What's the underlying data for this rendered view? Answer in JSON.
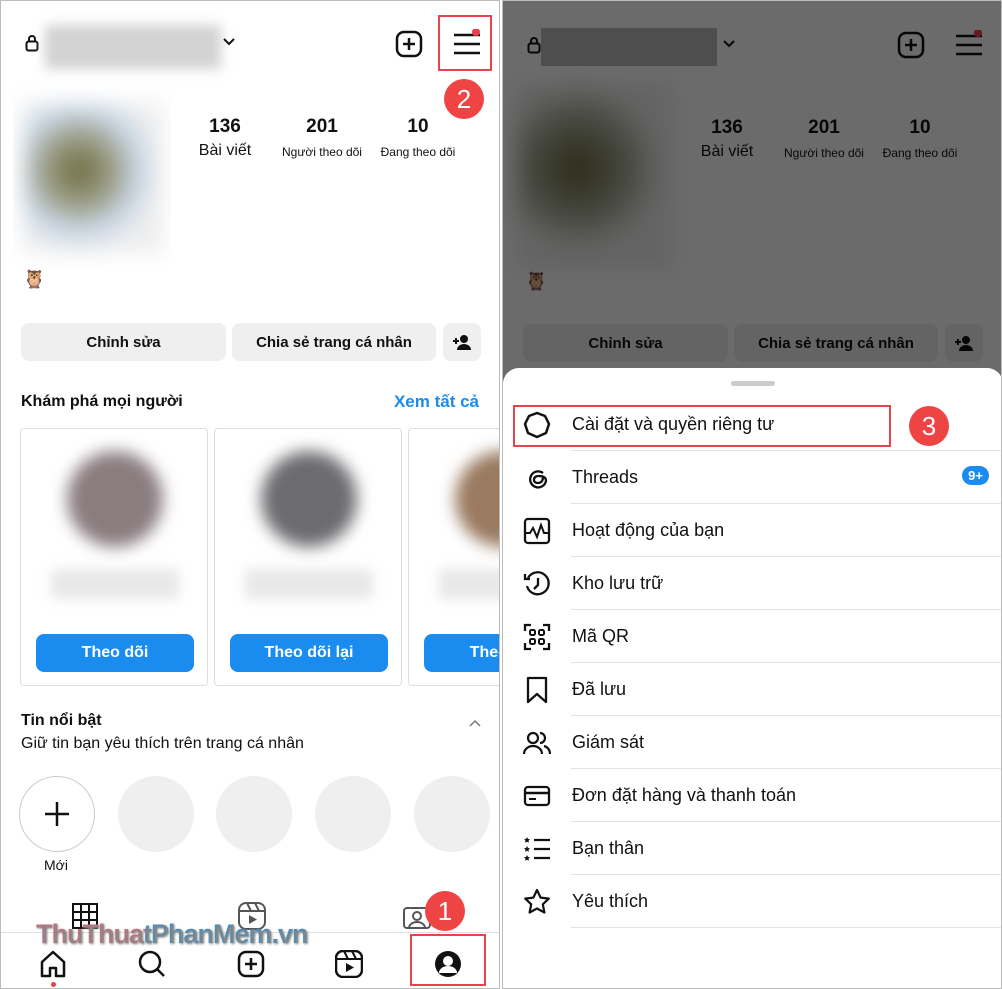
{
  "header": {
    "username_blurred": true
  },
  "profile": {
    "stats": [
      {
        "value": "136",
        "label": "Bài viết"
      },
      {
        "value": "201",
        "label": "Người theo dõi"
      },
      {
        "value": "10",
        "label": "Đang theo dõi"
      }
    ],
    "emoji": "🦉",
    "edit_label": "Chỉnh sửa",
    "share_label": "Chia sẻ trang cá nhân"
  },
  "discover": {
    "title": "Khám phá mọi người",
    "see_all": "Xem tất cả",
    "cards": [
      {
        "button": "Theo dõi"
      },
      {
        "button": "Theo dõi lại"
      },
      {
        "button": "Theo dõi"
      }
    ]
  },
  "highlights": {
    "title": "Tin nổi bật",
    "subtitle": "Giữ tin bạn yêu thích trên trang cá nhân",
    "new_label": "Mới"
  },
  "annotations": {
    "step1": "1",
    "step2": "2",
    "step3": "3"
  },
  "watermark": "ThuThuatPhanMem.vn",
  "menu": {
    "items": [
      {
        "label": "Cài đặt và quyền riêng tư",
        "icon": "settings-icon"
      },
      {
        "label": "Threads",
        "icon": "threads-icon",
        "badge": "9+"
      },
      {
        "label": "Hoạt động của bạn",
        "icon": "activity-icon"
      },
      {
        "label": "Kho lưu trữ",
        "icon": "archive-icon"
      },
      {
        "label": "Mã QR",
        "icon": "qr-icon"
      },
      {
        "label": "Đã lưu",
        "icon": "bookmark-icon"
      },
      {
        "label": "Giám sát",
        "icon": "supervision-icon"
      },
      {
        "label": "Đơn đặt hàng và thanh toán",
        "icon": "card-icon"
      },
      {
        "label": "Bạn thân",
        "icon": "close-friends-icon"
      },
      {
        "label": "Yêu thích",
        "icon": "star-icon"
      }
    ]
  },
  "colors": {
    "accent": "#1a8cf0",
    "annotation": "#ef4444",
    "badge": "#1a8cf0"
  }
}
